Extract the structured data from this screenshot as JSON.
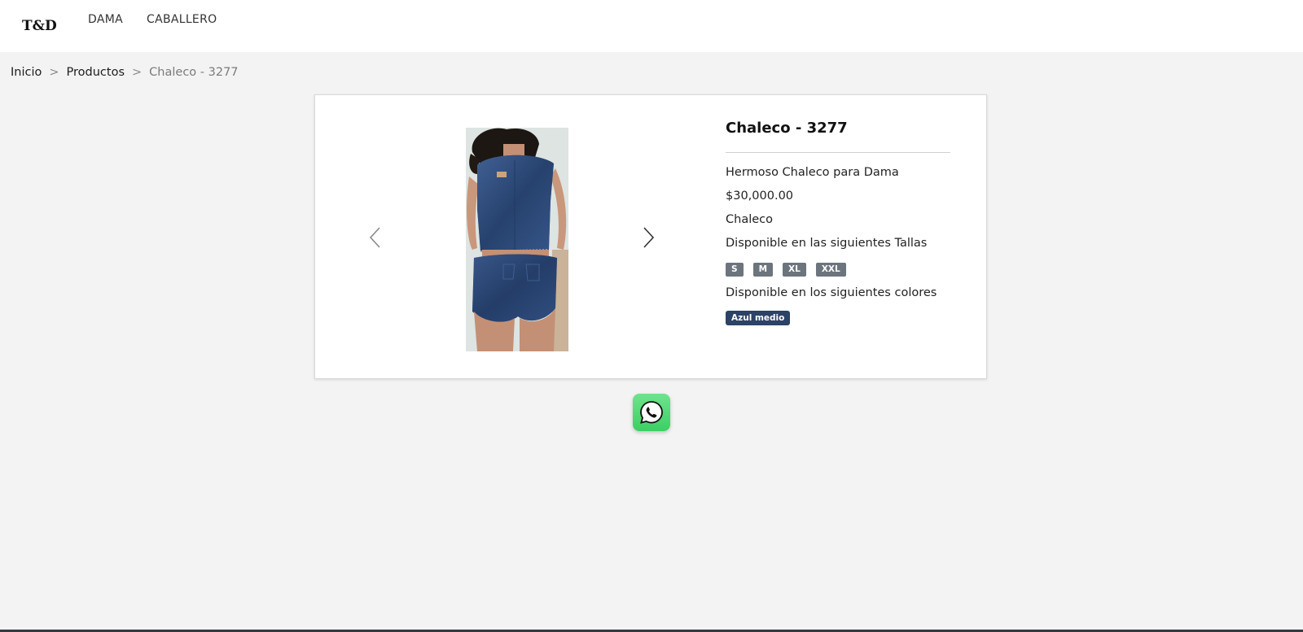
{
  "brand": {
    "logo_text": "T&D"
  },
  "nav": {
    "items": [
      {
        "label": "DAMA"
      },
      {
        "label": "CABALLERO"
      }
    ]
  },
  "breadcrumb": {
    "items": [
      {
        "label": "Inicio"
      },
      {
        "label": "Productos"
      },
      {
        "label": "Chaleco - 3277"
      }
    ],
    "separator": ">"
  },
  "product": {
    "title": "Chaleco - 3277",
    "description": "Hermoso Chaleco para Dama",
    "price": "$30,000.00",
    "category": "Chaleco",
    "sizes_label": "Disponible en las siguientes Tallas",
    "sizes": [
      "S",
      "M",
      "XL",
      "XXL"
    ],
    "colors_label": "Disponible en los siguientes colores",
    "colors": [
      "Azul medio"
    ],
    "image_icon": "denim-vest-photo"
  },
  "carousel": {
    "prev_icon": "chevron-left-icon",
    "next_icon": "chevron-right-icon"
  },
  "whatsapp": {
    "icon": "whatsapp-icon",
    "color": "#3ccf63"
  },
  "theme": {
    "size_badge_color": "#6c757d",
    "color_badge_color": "#2c4266",
    "background": "#f3f3f3"
  }
}
